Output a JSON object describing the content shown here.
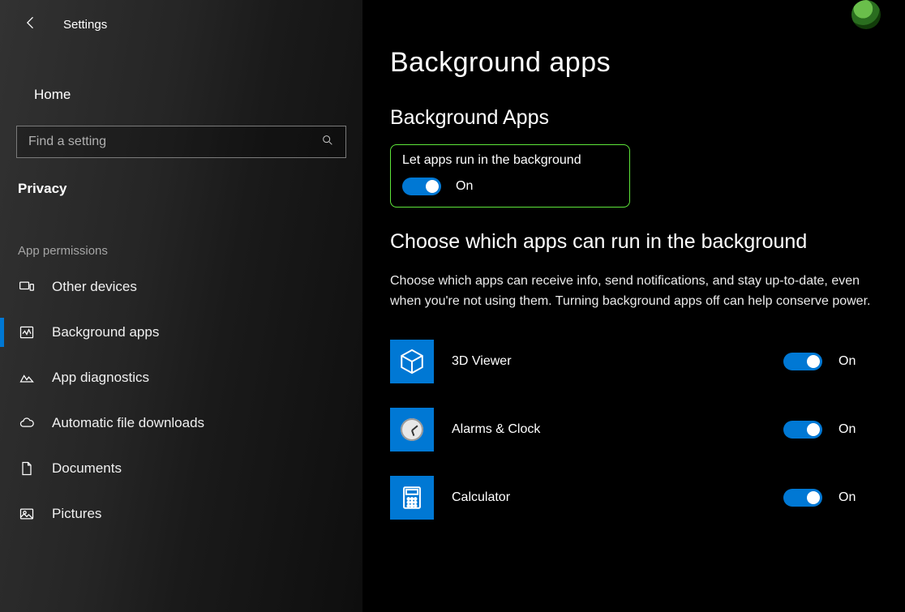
{
  "titlebar": {
    "title": "Settings"
  },
  "sidebar": {
    "home_label": "Home",
    "search_placeholder": "Find a setting",
    "category_label": "Privacy",
    "group_label": "App permissions",
    "items": [
      {
        "id": "other-devices",
        "label": "Other devices"
      },
      {
        "id": "background-apps",
        "label": "Background apps"
      },
      {
        "id": "app-diagnostics",
        "label": "App diagnostics"
      },
      {
        "id": "automatic-file-downloads",
        "label": "Automatic file downloads"
      },
      {
        "id": "documents",
        "label": "Documents"
      },
      {
        "id": "pictures",
        "label": "Pictures"
      }
    ],
    "active_index": 1
  },
  "main": {
    "page_title": "Background apps",
    "section1_title": "Background Apps",
    "master_toggle": {
      "label": "Let apps run in the background",
      "state_label": "On",
      "on": true
    },
    "section2_title": "Choose which apps can run in the background",
    "description": "Choose which apps can receive info, send notifications, and stay up-to-date, even when you're not using them. Turning background apps off can help conserve power.",
    "apps": [
      {
        "name": "3D Viewer",
        "icon": "cube-icon",
        "state_label": "On",
        "on": true
      },
      {
        "name": "Alarms & Clock",
        "icon": "clock-icon",
        "state_label": "On",
        "on": true
      },
      {
        "name": "Calculator",
        "icon": "calculator-icon",
        "state_label": "On",
        "on": true
      }
    ]
  },
  "colors": {
    "accent": "#0078d4",
    "highlight_border": "#5ee63a"
  }
}
